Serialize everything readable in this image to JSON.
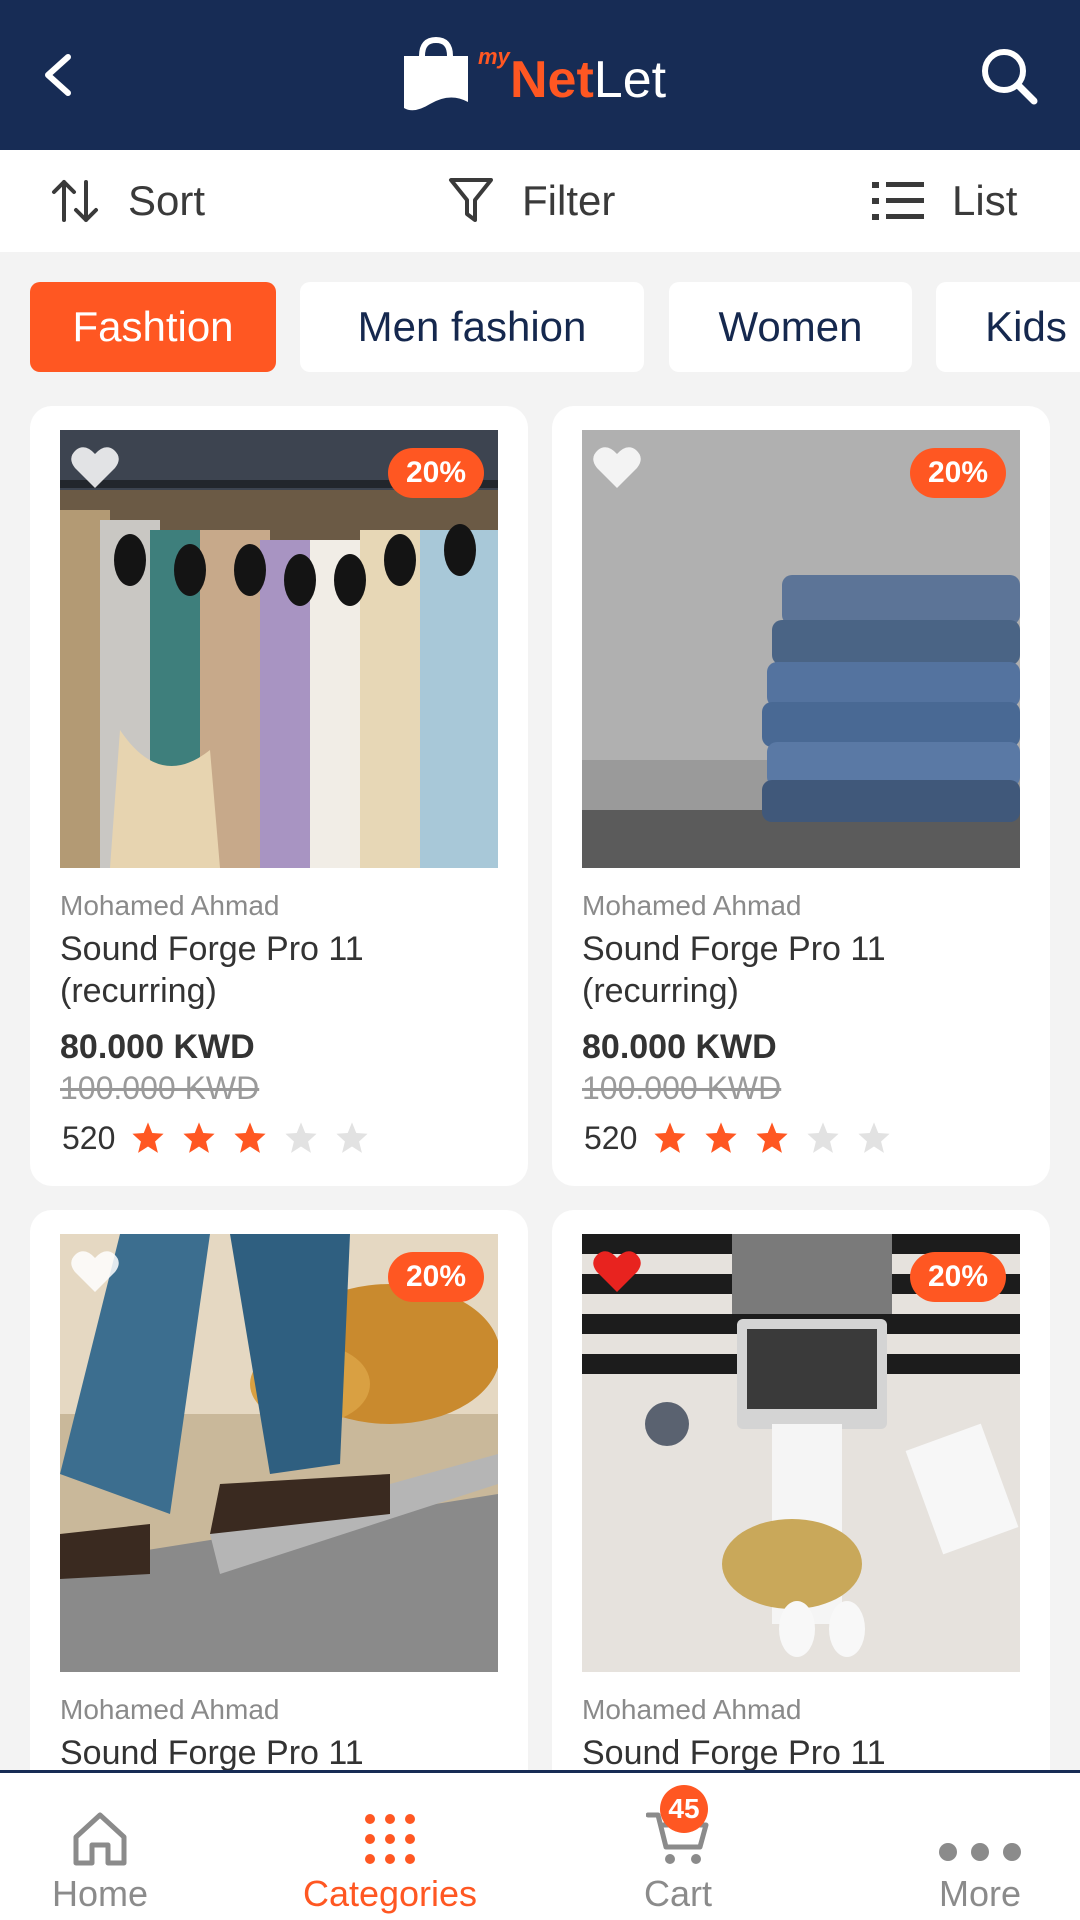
{
  "header": {
    "logo_my": "my",
    "logo_net": "Net",
    "logo_let": "Let"
  },
  "toolbar": {
    "sort_label": "Sort",
    "filter_label": "Filter",
    "list_label": "List"
  },
  "categories": [
    {
      "label": "Fashtion",
      "active": true
    },
    {
      "label": "Men fashion",
      "active": false
    },
    {
      "label": "Women",
      "active": false
    },
    {
      "label": "Kids",
      "active": false
    }
  ],
  "products": [
    {
      "seller": "Mohamed Ahmad",
      "title": "Sound Forge Pro 11 (recurring)",
      "price": "80.000 KWD",
      "old_price": "100.000 KWD",
      "reviews": "520",
      "rating": 3,
      "discount": "20%",
      "favorited": false,
      "image": "dresses-on-rack"
    },
    {
      "seller": "Mohamed Ahmad",
      "title": "Sound Forge Pro 11 (recurring)",
      "price": "80.000 KWD",
      "old_price": "100.000 KWD",
      "reviews": "520",
      "rating": 3,
      "discount": "20%",
      "favorited": false,
      "image": "stacked-jeans"
    },
    {
      "seller": "Mohamed Ahmad",
      "title": "Sound Forge Pro 11",
      "discount": "20%",
      "favorited": false,
      "image": "jeans-and-boots-on-steps"
    },
    {
      "seller": "Mohamed Ahmad",
      "title": "Sound Forge Pro 11",
      "discount": "20%",
      "favorited": true,
      "image": "laptop-flatlay"
    }
  ],
  "bottom_nav": {
    "home": "Home",
    "categories": "Categories",
    "cart": "Cart",
    "cart_count": "45",
    "more": "More"
  },
  "colors": {
    "primary": "#172c55",
    "accent": "#ff5722",
    "background": "#f3f3f3"
  }
}
